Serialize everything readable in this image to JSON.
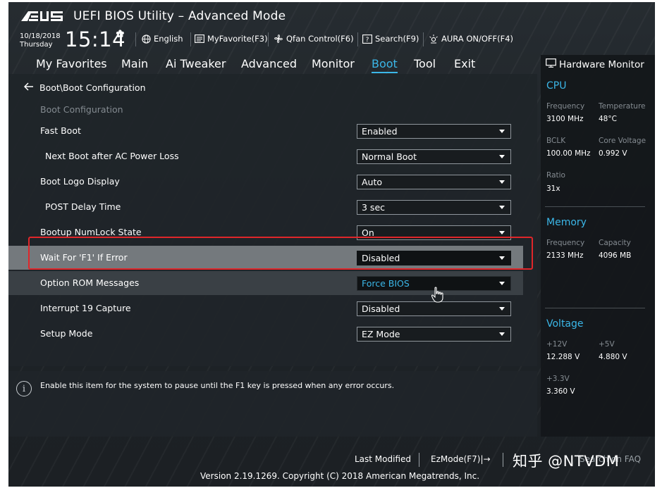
{
  "header": {
    "logo": "ASUS",
    "title": "UEFI BIOS Utility – Advanced Mode",
    "date": "10/18/2018",
    "day": "Thursday",
    "time": "15:14",
    "tools": [
      {
        "icon": "globe-icon",
        "label": "English"
      },
      {
        "icon": "favorite-icon",
        "label": "MyFavorite(F3)"
      },
      {
        "icon": "fan-icon",
        "label": "Qfan Control(F6)"
      },
      {
        "icon": "search-help-icon",
        "label": "Search(F9)"
      },
      {
        "icon": "aura-icon",
        "label": "AURA ON/OFF(F4)"
      }
    ]
  },
  "nav": {
    "tabs": [
      "My Favorites",
      "Main",
      "Ai Tweaker",
      "Advanced",
      "Monitor",
      "Boot",
      "Tool",
      "Exit"
    ],
    "active": "Boot"
  },
  "breadcrumb": "Boot\\Boot Configuration",
  "section_label": "Boot Configuration",
  "settings": [
    {
      "label": "Fast Boot",
      "value": "Enabled"
    },
    {
      "label": "Next Boot after AC Power Loss",
      "value": "Normal Boot"
    },
    {
      "label": "Boot Logo Display",
      "value": "Auto"
    },
    {
      "label": "POST Delay Time",
      "value": "3 sec"
    },
    {
      "label": "Bootup NumLock State",
      "value": "On"
    },
    {
      "label": "Wait For 'F1' If Error",
      "value": "Disabled"
    },
    {
      "label": "Option ROM Messages",
      "value": "Force BIOS"
    },
    {
      "label": "Interrupt 19 Capture",
      "value": "Disabled"
    },
    {
      "label": "Setup Mode",
      "value": "EZ Mode"
    }
  ],
  "help_text": "Enable this item for the system to pause until the F1 key is pressed when any error occurs.",
  "hardware_monitor": {
    "title": "Hardware Monitor",
    "cpu": {
      "title": "CPU",
      "frequency_label": "Frequency",
      "frequency": "3100 MHz",
      "temperature_label": "Temperature",
      "temperature": "48°C",
      "bclk_label": "BCLK",
      "bclk": "100.00 MHz",
      "core_voltage_label": "Core Voltage",
      "core_voltage": "0.992 V",
      "ratio_label": "Ratio",
      "ratio": "31x"
    },
    "memory": {
      "title": "Memory",
      "frequency_label": "Frequency",
      "frequency": "2133 MHz",
      "capacity_label": "Capacity",
      "capacity": "4096 MB"
    },
    "voltage": {
      "title": "Voltage",
      "v12_label": "+12V",
      "v12": "12.288 V",
      "v5_label": "+5V",
      "v5": "4.880 V",
      "v33_label": "+3.3V",
      "v33": "3.360 V"
    }
  },
  "footer": {
    "last_modified": "Last Modified",
    "ezmode": "EzMode(F7)|→",
    "search_faq": "Search on FAQ",
    "version": "Version 2.19.1269. Copyright (C) 2018 American Megatrends, Inc.",
    "watermark": "知乎 @NTVDM"
  },
  "colors": {
    "accent": "#3bb7e8",
    "highlight_box": "#e0262a"
  }
}
